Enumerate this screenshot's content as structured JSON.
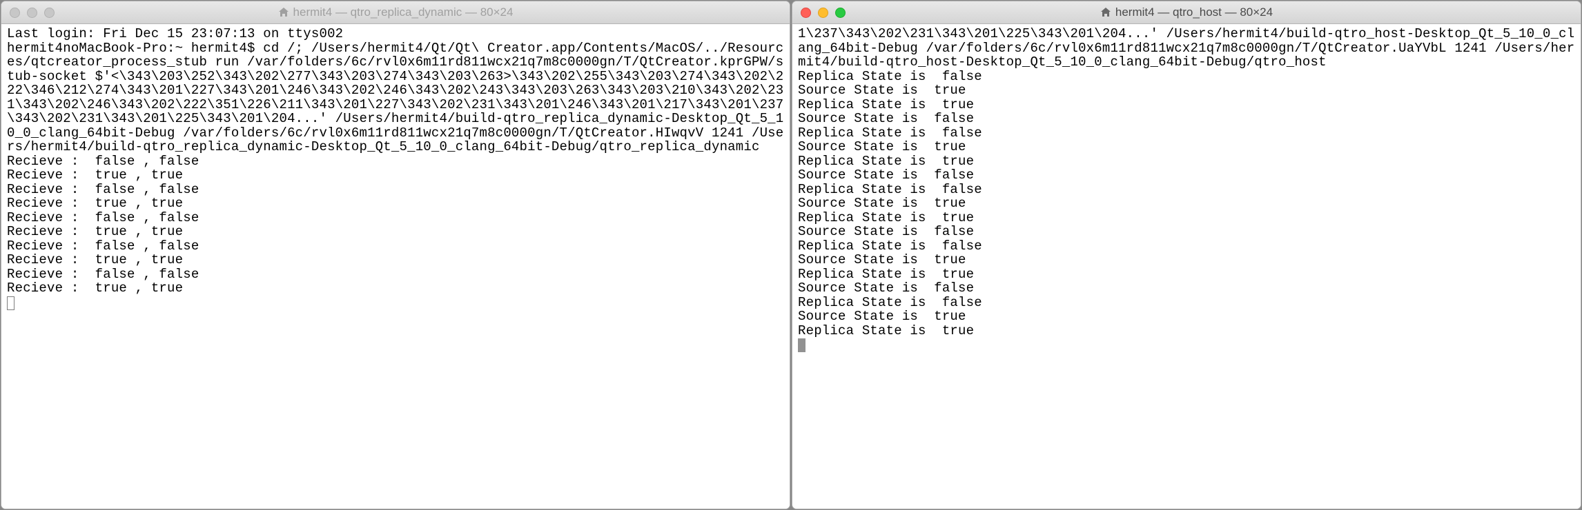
{
  "windows": [
    {
      "active": false,
      "title": "hermit4 — qtro_replica_dynamic — 80×24",
      "lines": [
        "Last login: Fri Dec 15 23:07:13 on ttys002",
        "hermit4noMacBook-Pro:~ hermit4$ cd /; /Users/hermit4/Qt/Qt\\ Creator.app/Contents/MacOS/../Resources/qtcreator_process_stub run /var/folders/6c/rvl0x6m11rd811wcx21q7m8c0000gn/T/QtCreator.kprGPW/stub-socket $'<\\343\\203\\252\\343\\202\\277\\343\\203\\274\\343\\203\\263>\\343\\202\\255\\343\\203\\274\\343\\202\\222\\346\\212\\274\\343\\201\\227\\343\\201\\246\\343\\202\\246\\343\\202\\243\\343\\203\\263\\343\\203\\210\\343\\202\\231\\343\\202\\246\\343\\202\\222\\351\\226\\211\\343\\201\\227\\343\\202\\231\\343\\201\\246\\343\\201\\217\\343\\201\\237\\343\\202\\231\\343\\201\\225\\343\\201\\204...' /Users/hermit4/build-qtro_replica_dynamic-Desktop_Qt_5_10_0_clang_64bit-Debug /var/folders/6c/rvl0x6m11rd811wcx21q7m8c0000gn/T/QtCreator.HIwqvV 1241 /Users/hermit4/build-qtro_replica_dynamic-Desktop_Qt_5_10_0_clang_64bit-Debug/qtro_replica_dynamic",
        "Recieve :  false , false",
        "Recieve :  true , true",
        "Recieve :  false , false",
        "Recieve :  true , true",
        "Recieve :  false , false",
        "Recieve :  true , true",
        "Recieve :  false , false",
        "Recieve :  true , true",
        "Recieve :  false , false",
        "Recieve :  true , true"
      ],
      "cursor_style": "outline"
    },
    {
      "active": true,
      "title": "hermit4 — qtro_host — 80×24",
      "lines": [
        "1\\237\\343\\202\\231\\343\\201\\225\\343\\201\\204...' /Users/hermit4/build-qtro_host-Desktop_Qt_5_10_0_clang_64bit-Debug /var/folders/6c/rvl0x6m11rd811wcx21q7m8c0000gn/T/QtCreator.UaYVbL 1241 /Users/hermit4/build-qtro_host-Desktop_Qt_5_10_0_clang_64bit-Debug/qtro_host",
        "Replica State is  false",
        "Source State is  true",
        "Replica State is  true",
        "Source State is  false",
        "Replica State is  false",
        "Source State is  true",
        "Replica State is  true",
        "Source State is  false",
        "Replica State is  false",
        "Source State is  true",
        "Replica State is  true",
        "Source State is  false",
        "Replica State is  false",
        "Source State is  true",
        "Replica State is  true",
        "Source State is  false",
        "Replica State is  false",
        "Source State is  true",
        "Replica State is  true"
      ],
      "cursor_style": "filled"
    }
  ]
}
